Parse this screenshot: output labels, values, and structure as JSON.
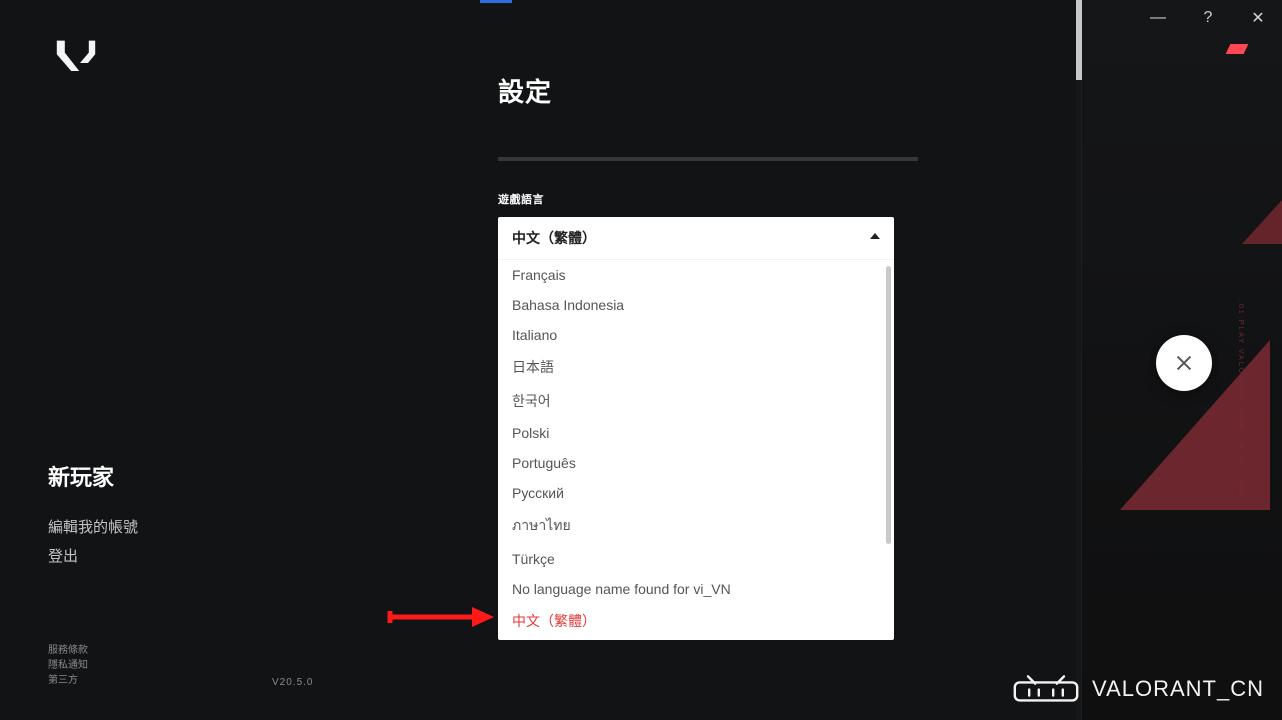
{
  "window": {
    "minimize": "—",
    "help": "?",
    "close": "✕"
  },
  "logo_alt": "VALORANT logo",
  "settings": {
    "title": "設定",
    "language_label": "遊戲語言",
    "selected": "中文（繁體）",
    "options": [
      "Français",
      "Bahasa Indonesia",
      "Italiano",
      "日本語",
      "한국어",
      "Polski",
      "Português",
      "Русский",
      "ภาษาไทย",
      "Türkçe",
      "No language name found for vi_VN",
      "中文（繁體）"
    ],
    "highlight_index": 11
  },
  "left": {
    "heading": "新玩家",
    "edit_account": "編輯我的帳號",
    "sign_out": "登出"
  },
  "footer": {
    "tos": "服務條款",
    "privacy": "隱私通知",
    "third": "第三方",
    "version": "V20.5.0"
  },
  "right_overlay_text": ".01  PLAY VALORANT  WWW . RSO . ORG",
  "watermark_text": "VALORANT_CN"
}
